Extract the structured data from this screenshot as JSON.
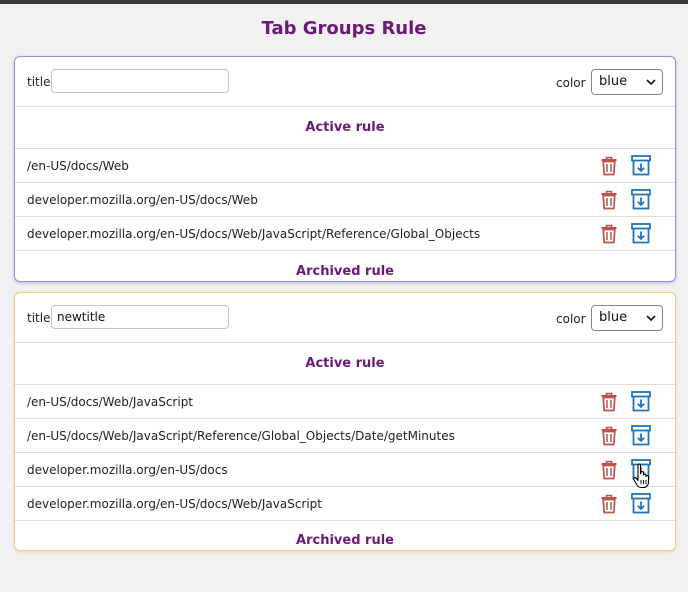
{
  "page": {
    "title": "Tab Groups Rule"
  },
  "colors": {
    "accent": "#6b1a75",
    "delete_icon": "#c0504d",
    "archive_icon": "#1e74b8"
  },
  "groups": [
    {
      "title_label": "title",
      "title_value": "",
      "color_label": "color",
      "color_value": "blue",
      "active_heading": "Active rule",
      "archived_heading": "Archived rule",
      "rules": [
        {
          "text": "/en-US/docs/Web",
          "delete_icon": "trash-icon",
          "archive_icon": "archive-icon"
        },
        {
          "text": "developer.mozilla.org/en-US/docs/Web",
          "delete_icon": "trash-icon",
          "archive_icon": "archive-icon"
        },
        {
          "text": "developer.mozilla.org/en-US/docs/Web/JavaScript/Reference/Global_Objects",
          "delete_icon": "trash-icon",
          "archive_icon": "archive-icon"
        }
      ]
    },
    {
      "title_label": "title",
      "title_value": "newtitle",
      "color_label": "color",
      "color_value": "blue",
      "active_heading": "Active rule",
      "archived_heading": "Archived rule",
      "rules": [
        {
          "text": "/en-US/docs/Web/JavaScript",
          "delete_icon": "trash-icon",
          "archive_icon": "archive-icon"
        },
        {
          "text": "/en-US/docs/Web/JavaScript/Reference/Global_Objects/Date/getMinutes",
          "delete_icon": "trash-icon",
          "archive_icon": "archive-icon"
        },
        {
          "text": "developer.mozilla.org/en-US/docs",
          "delete_icon": "trash-icon",
          "archive_icon": "archive-icon"
        },
        {
          "text": "developer.mozilla.org/en-US/docs/Web/JavaScript",
          "delete_icon": "trash-icon",
          "archive_icon": "archive-icon"
        }
      ]
    }
  ]
}
